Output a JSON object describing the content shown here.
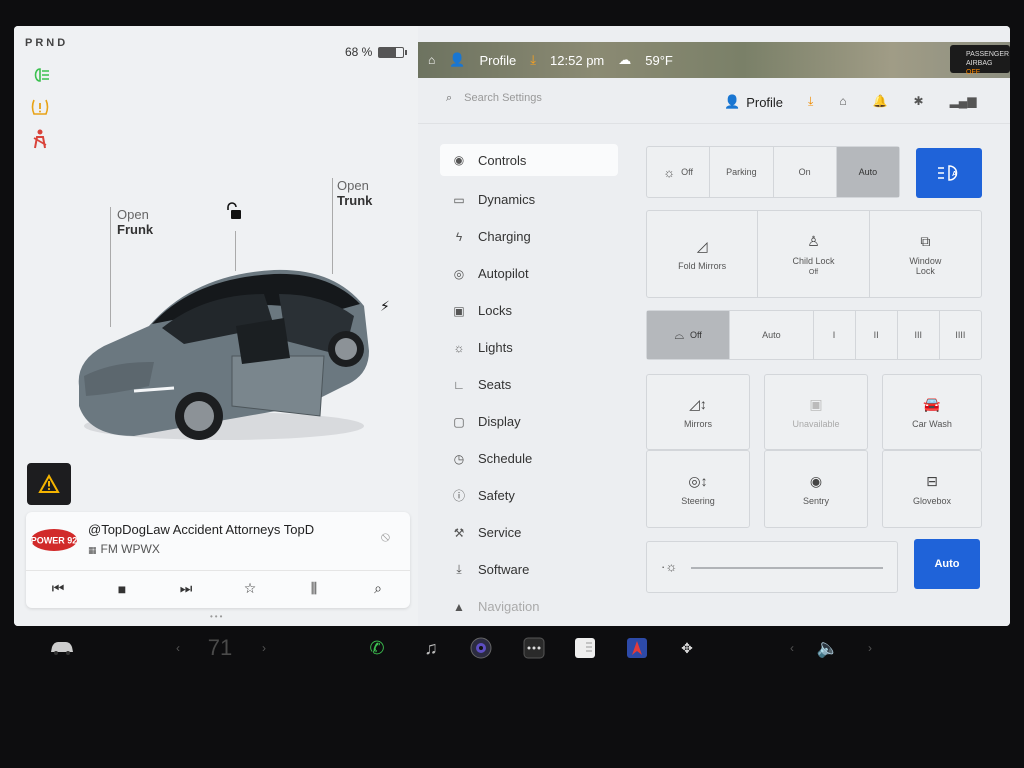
{
  "status": {
    "gear": "PRND",
    "battery_percent": "68 %",
    "battery_level": 0.68
  },
  "car_labels": {
    "frunk_top": "Open",
    "frunk_bottom": "Frunk",
    "trunk_top": "Open",
    "trunk_bottom": "Trunk"
  },
  "media": {
    "title": "@TopDogLaw Accident Attorneys TopD",
    "subtitle": "FM WPWX",
    "station_logo_text": "POWER 92"
  },
  "map_bar": {
    "profile": "Profile",
    "time": "12:52 pm",
    "temp": "59°F",
    "airbag_line1": "PASSENGER",
    "airbag_line2": "AIRBAG",
    "airbag_state": "OFF"
  },
  "topbar": {
    "search_placeholder": "Search Settings",
    "profile": "Profile"
  },
  "nav": [
    {
      "label": "Controls",
      "icon": "toggle-icon"
    },
    {
      "label": "Dynamics",
      "icon": "car-icon"
    },
    {
      "label": "Charging",
      "icon": "bolt-icon"
    },
    {
      "label": "Autopilot",
      "icon": "steering-icon"
    },
    {
      "label": "Locks",
      "icon": "lock-icon"
    },
    {
      "label": "Lights",
      "icon": "sun-icon"
    },
    {
      "label": "Seats",
      "icon": "seat-icon"
    },
    {
      "label": "Display",
      "icon": "display-icon"
    },
    {
      "label": "Schedule",
      "icon": "clock-icon"
    },
    {
      "label": "Safety",
      "icon": "info-icon"
    },
    {
      "label": "Service",
      "icon": "wrench-icon"
    },
    {
      "label": "Software",
      "icon": "download-icon"
    },
    {
      "label": "Navigation",
      "icon": "nav-icon"
    }
  ],
  "lights": {
    "off": "Off",
    "parking": "Parking",
    "on": "On",
    "auto": "Auto",
    "selected": "Auto"
  },
  "row2": {
    "fold_mirrors": "Fold Mirrors",
    "child_lock": "Child Lock",
    "child_lock_state": "Off",
    "window_lock_1": "Window",
    "window_lock_2": "Lock"
  },
  "wipers": {
    "off": "Off",
    "auto": "Auto",
    "levels": [
      "I",
      "II",
      "III",
      "IIII"
    ],
    "selected": "Off"
  },
  "tiles": {
    "mirrors": "Mirrors",
    "unavailable": "Unavailable",
    "car_wash": "Car Wash",
    "steering": "Steering",
    "sentry": "Sentry",
    "glovebox": "Glovebox"
  },
  "brightness": {
    "auto": "Auto"
  },
  "dock": {
    "temp": "71"
  },
  "colors": {
    "accent": "#1f63d9",
    "warning": "#e8a317",
    "alert": "#d9433a",
    "green": "#3cc150"
  }
}
